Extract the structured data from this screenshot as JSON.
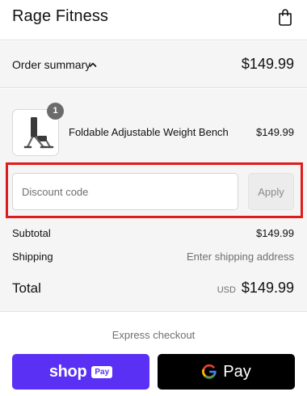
{
  "header": {
    "store_name": "Rage Fitness",
    "cart_icon": "shopping-bag-icon"
  },
  "summary": {
    "label": "Order summary",
    "total": "$149.99",
    "chevron": "chevron-up-icon"
  },
  "item": {
    "name": "Foldable Adjustable Weight Bench",
    "price": "$149.99",
    "quantity": "1"
  },
  "discount": {
    "placeholder": "Discount code",
    "value": "",
    "apply_label": "Apply"
  },
  "totals": {
    "subtotal_label": "Subtotal",
    "subtotal_value": "$149.99",
    "shipping_label": "Shipping",
    "shipping_value": "Enter shipping address",
    "total_label": "Total",
    "currency": "USD",
    "total_value": "$149.99"
  },
  "express": {
    "label": "Express checkout",
    "shop_pay": {
      "word": "shop",
      "pill": "Pay",
      "color": "#5a31f4"
    },
    "google_pay": {
      "word": "Pay",
      "color": "#000000"
    }
  },
  "colors": {
    "highlight": "#e01b1b",
    "panel_bg": "#f5f5f5"
  }
}
